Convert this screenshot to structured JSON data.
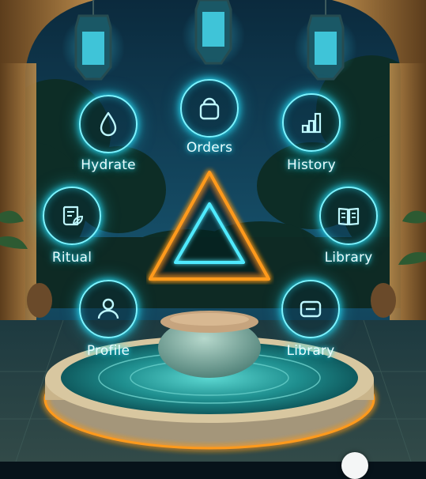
{
  "menu": {
    "items": [
      {
        "id": "orders",
        "label": "Orders",
        "icon": "shopping-bag-icon"
      },
      {
        "id": "hydrate",
        "label": "Hydrate",
        "icon": "water-drop-icon"
      },
      {
        "id": "history",
        "label": "History",
        "icon": "bar-chart-icon"
      },
      {
        "id": "ritual",
        "label": "Ritual",
        "icon": "scroll-leaf-icon"
      },
      {
        "id": "library",
        "label": "Library",
        "icon": "open-book-icon"
      },
      {
        "id": "profile",
        "label": "Profile",
        "icon": "user-icon"
      },
      {
        "id": "library2",
        "label": "Library",
        "icon": "minus-box-icon"
      }
    ]
  },
  "colors": {
    "neon_cyan": "#27e3ff",
    "neon_orange": "#ff9a1f",
    "sky": "#0b2f45",
    "stone": "#c9b48a"
  }
}
